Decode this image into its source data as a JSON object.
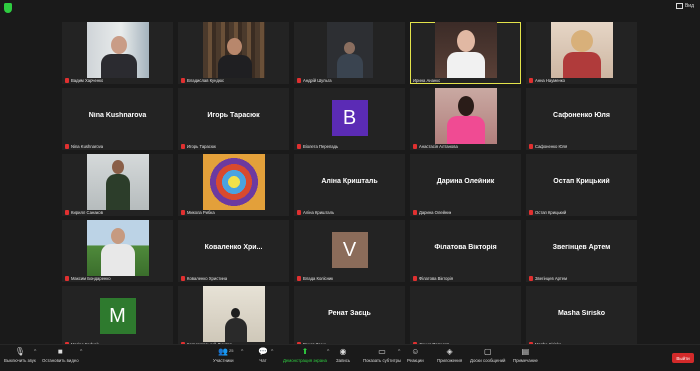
{
  "topbar": {
    "view_label": "Вид"
  },
  "tiles": [
    {
      "label": "Вадим Харченко"
    },
    {
      "label": "Владислав Кундюс"
    },
    {
      "label": "Андрій Шульга"
    },
    {
      "label": "Ирина Ананко"
    },
    {
      "label": "Анна Науменко"
    },
    {
      "name": "Nina Kushnarova",
      "label": "Nina Kushnarova"
    },
    {
      "name": "Игорь Тарасюк",
      "label": "Игорь Тарасюк"
    },
    {
      "avatar_letter": "B",
      "avatar_color": "#5b2bb5",
      "label": "Віолета Перепадь"
    },
    {
      "label": "Анастасія Алтанова"
    },
    {
      "name": "Сафоненко Юля",
      "label": "Сафоненко Юля"
    },
    {
      "label": "Кирилл Санаков"
    },
    {
      "label": "Микола Рибка"
    },
    {
      "name": "Аліна Кришталь",
      "label": "Аліна Кришталь"
    },
    {
      "name": "Дарина Олейник",
      "label": "Дарина Олейник"
    },
    {
      "name": "Остап Крицький",
      "label": "Остап Крицький"
    },
    {
      "label": "Максим Бондаренко"
    },
    {
      "name": "Коваленко  Хри...",
      "label": "Коваленко Христина"
    },
    {
      "avatar_letter": "V",
      "avatar_color": "#8b6c5a",
      "label": "Влада Колісник"
    },
    {
      "name": "Філатова Вікторія",
      "label": "Філатова Вікторія"
    },
    {
      "name": "Звегінцев Артем",
      "label": "Звегінцев Артем"
    },
    {
      "avatar_letter": "M",
      "avatar_color": "#2e7a2e",
      "label": "Marina Fedyak"
    },
    {
      "label": "Колмогорський Дмитро"
    },
    {
      "name": "Ренат Заєць",
      "label": "Ренат Заєць"
    },
    {
      "name": "",
      "label": "Данил Попелов"
    },
    {
      "name": "Masha Sirisko",
      "label": "Masha Sirisko"
    }
  ],
  "toolbar": {
    "mute": "Выключить звук",
    "video": "Остановить видео",
    "participants": "Участники",
    "participants_count": "25",
    "chat": "Чат",
    "share": "Демонстрация экрана",
    "record": "Запись",
    "captions": "Показать субтитры",
    "reactions": "Реакции",
    "apps": "Приложения",
    "whiteboard": "Доски сообщений",
    "notes": "Примечание",
    "leave": "Выйти"
  },
  "colors": {
    "accent": "#2ecc40",
    "leave": "#d32a2a",
    "active_border": "#e3e34a"
  }
}
